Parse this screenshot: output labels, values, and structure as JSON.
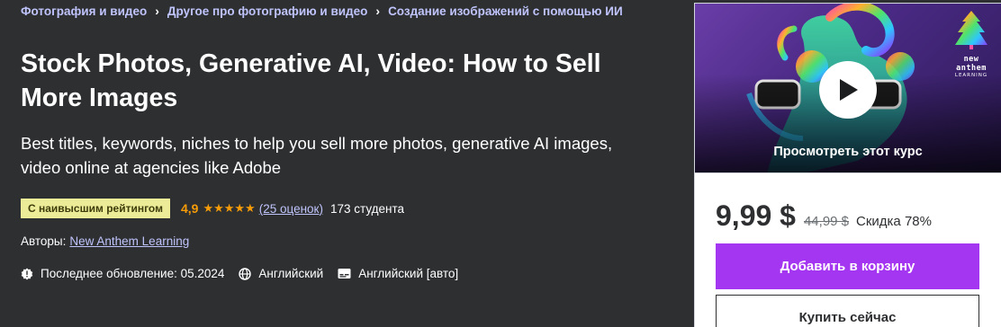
{
  "breadcrumb": [
    "Фотография и видео",
    "Другое про фотографию и видео",
    "Создание изображений с помощью ИИ"
  ],
  "course": {
    "title": "Stock Photos, Generative AI, Video: How to Sell More Images",
    "subtitle": "Best titles, keywords, niches to help you sell more photos, generative AI images, video online at agencies like Adobe",
    "badge": "С наивысшим рейтингом",
    "rating": "4,9",
    "stars": 5,
    "reviews": "(25 оценок)",
    "students": "173 студента",
    "authors_label": "Авторы:",
    "author": "New Anthem Learning",
    "last_updated": "Последнее обновление: 05.2024",
    "language": "Английский",
    "captions": "Английский [авто]"
  },
  "card": {
    "preview_label": "Просмотреть этот курс",
    "brand_line1": "new anthem",
    "brand_line2": "LEARNING",
    "price": "9,99 $",
    "old_price": "44,99 $",
    "discount": "Скидка 78%",
    "add_to_cart": "Добавить в корзину",
    "buy_now": "Купить сейчас"
  },
  "colors": {
    "background": "#2d2f31",
    "link": "#c0c4fc",
    "badge_bg": "#eceb98",
    "star": "#f69c08",
    "cart_button": "#a435f0"
  }
}
